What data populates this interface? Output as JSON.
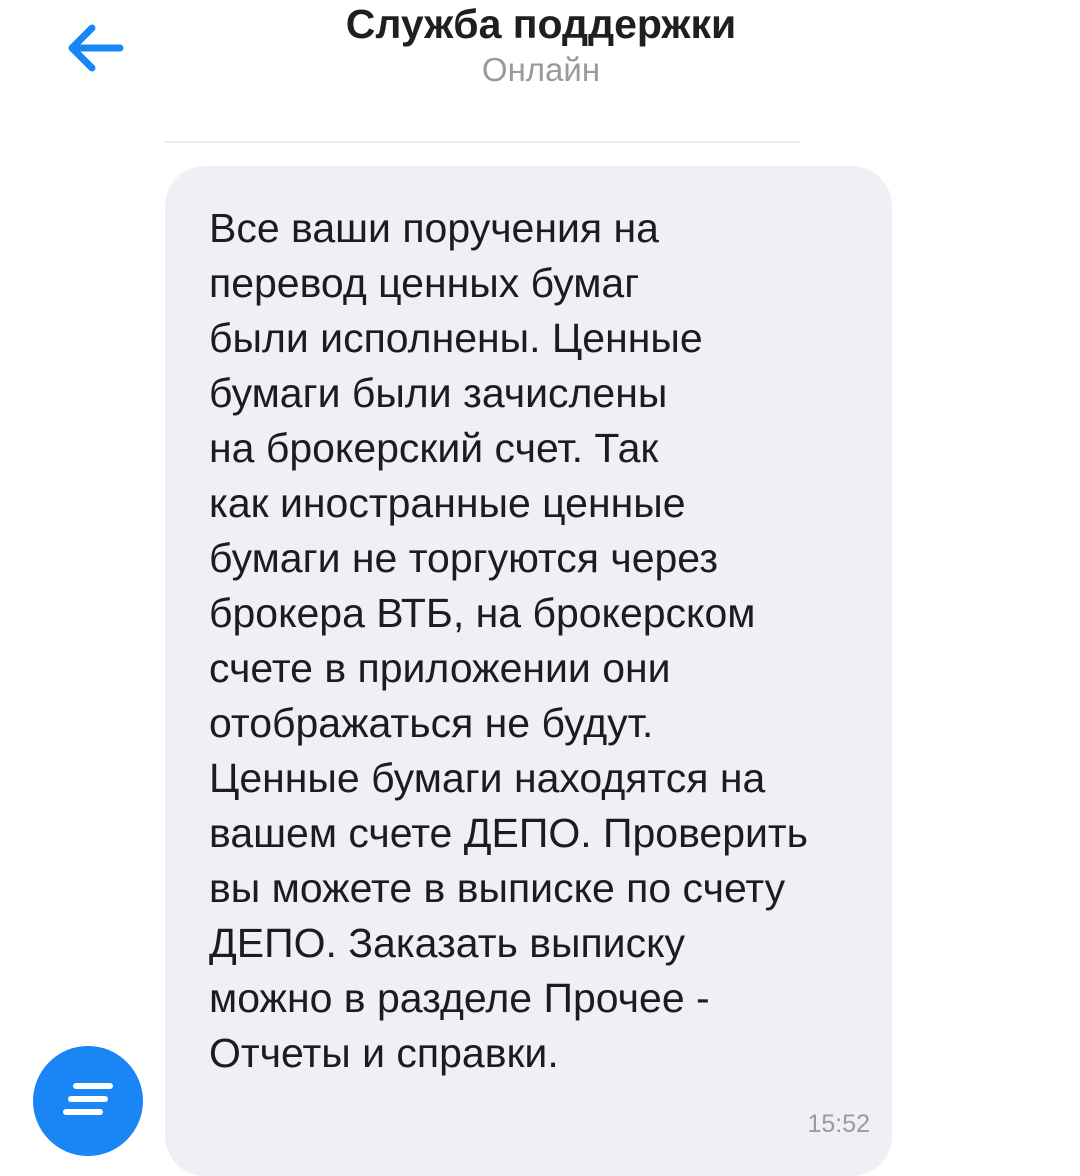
{
  "header": {
    "title": "Служба поддержки",
    "status": "Онлайн",
    "back_icon": "arrow-left-icon"
  },
  "message": {
    "lines": [
      "Все ваши поручения на",
      "перевод ценных бумаг",
      "были исполнены. Ценные",
      "бумаги были зачислены",
      "на брокерский счет. Так",
      "как иностранные ценные",
      "бумаги не торгуются через",
      "брокера ВТБ, на брокерском",
      "счете в приложении они",
      "отображаться не будут.",
      "Ценные бумаги находятся на",
      "вашем счете ДЕПО. Проверить",
      "вы можете в выписке по счету",
      "ДЕПО. Заказать выписку",
      "можно в разделе Прочее -",
      "Отчеты и справки."
    ],
    "time": "15:52"
  },
  "fab": {
    "icon": "menu-lines-icon"
  },
  "colors": {
    "accent": "#1a86f5",
    "bubble": "#eff0f5",
    "text": "#1c1c1c",
    "muted": "#9a9a9a"
  }
}
